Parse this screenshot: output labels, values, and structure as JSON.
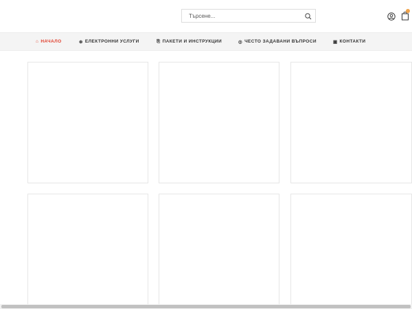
{
  "search": {
    "placeholder": "Търсене..."
  },
  "header": {
    "user_icon": "user-circle-icon",
    "cart_icon": "shopping-bag-icon",
    "badge_color": "#f0a34a"
  },
  "nav": {
    "active_color": "#e0412f",
    "items": [
      {
        "icon": "⌂",
        "icon_name": "home-icon",
        "label": "НАЧАЛО"
      },
      {
        "icon": "⊛",
        "icon_name": "gear-icon",
        "label": "ЕЛЕКТРОННИ УСЛУГИ"
      },
      {
        "icon": "⎘",
        "icon_name": "copy-icon",
        "label": "ПАКЕТИ И ИНСТРУКЦИИ"
      },
      {
        "icon": "◎",
        "icon_name": "question-icon",
        "label": "ЧЕСТО ЗАДАВАНИ ВЪПРОСИ"
      },
      {
        "icon": "▣",
        "icon_name": "phone-icon",
        "label": "КОНТАКТИ"
      }
    ]
  }
}
